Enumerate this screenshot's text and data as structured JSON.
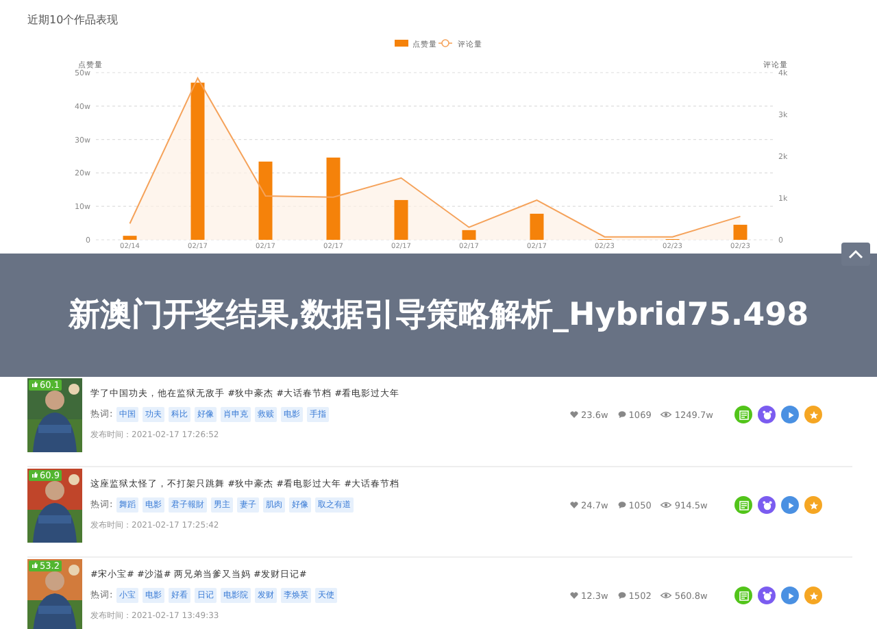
{
  "section_title": "近期10个作品表现",
  "chart": {
    "chart_data": {
      "type": "bar",
      "categories": [
        "02/14",
        "02/17",
        "02/17",
        "02/17",
        "02/17",
        "02/17",
        "02/17",
        "02/23",
        "02/23",
        "02/23"
      ],
      "series": [
        {
          "name": "点赞量",
          "type": "bar",
          "color": "#f5820a",
          "values": [
            1.2,
            47,
            23.4,
            24.6,
            11.9,
            2.9,
            7.8,
            0.2,
            0.2,
            4.5
          ]
        },
        {
          "name": "评论量",
          "type": "area",
          "axis": "y2",
          "color": "#f5a25a",
          "values": [
            390,
            3870,
            1050,
            1020,
            1480,
            300,
            950,
            70,
            70,
            560
          ]
        }
      ],
      "grid": true,
      "legend": true,
      "ylim": [
        0,
        50
      ],
      "y2lim": [
        0,
        4000
      ],
      "ylabel": "点赞量",
      "y2label": "评论量",
      "yticks": [
        {
          "value": 0,
          "label": "0"
        },
        {
          "value": 10,
          "label": "10w"
        },
        {
          "value": 20,
          "label": "20w"
        },
        {
          "value": 30,
          "label": "30w"
        },
        {
          "value": 40,
          "label": "40w"
        },
        {
          "value": 50,
          "label": "50w"
        }
      ],
      "y2ticks": [
        {
          "value": 0,
          "label": "0"
        },
        {
          "value": 1000,
          "label": "1k"
        },
        {
          "value": 2000,
          "label": "2k"
        },
        {
          "value": 3000,
          "label": "3k"
        },
        {
          "value": 4000,
          "label": "4k"
        }
      ]
    }
  },
  "works": [
    {
      "score": "60.1",
      "title": "学了中国功夫，他在监狱无敌手  #狄中豪杰 #大话春节档 #看电影过大年",
      "hotword_label": "热词:",
      "tags": [
        "中国",
        "功夫",
        "科比",
        "好像",
        "肖申克",
        "救赎",
        "电影",
        "手指"
      ],
      "time": "发布时间：2021-02-17 17:26:52",
      "likes": "23.6w",
      "comments": "1069",
      "views": "1249.7w"
    },
    {
      "score": "60.9",
      "title": "这座监狱太怪了，不打架只跳舞 #狄中豪杰 #看电影过大年 #大话春节档",
      "hotword_label": "热词:",
      "tags": [
        "舞蹈",
        "电影",
        "君子報財",
        "男主",
        "妻子",
        "肌肉",
        "好像",
        "取之有道"
      ],
      "time": "发布时间：2021-02-17 17:25:42",
      "likes": "24.7w",
      "comments": "1050",
      "views": "914.5w"
    },
    {
      "score": "53.2",
      "title": "#宋小宝# #沙溢# 两兄弟当爹又当妈 #发财日记#",
      "hotword_label": "热词:",
      "tags": [
        "小宝",
        "电影",
        "好看",
        "日记",
        "电影院",
        "发财",
        "李焕英",
        "天使"
      ],
      "time": "发布时间：2021-02-17 13:49:33",
      "likes": "12.3w",
      "comments": "1502",
      "views": "560.8w"
    }
  ],
  "banner": {
    "title": "新澳门开奖结果,数据引导策略解析_Hybrid75.498"
  }
}
